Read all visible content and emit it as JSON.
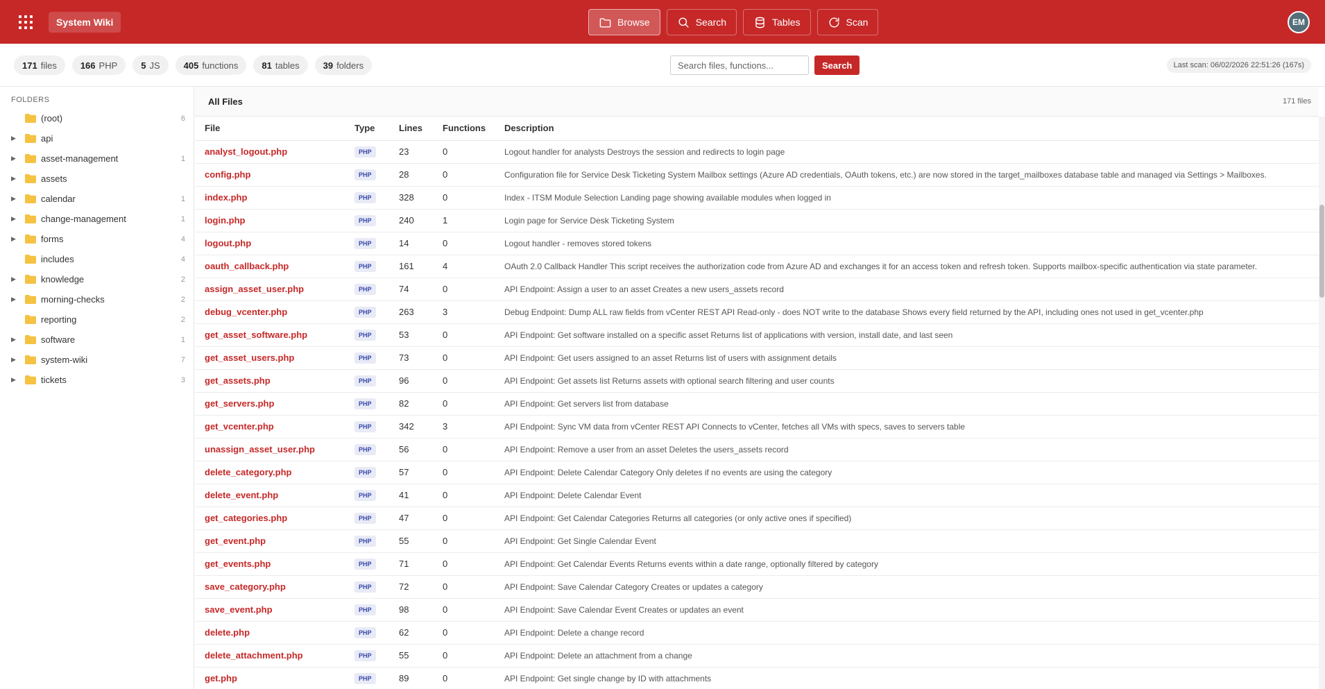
{
  "header": {
    "brand": "System Wiki",
    "nav": [
      {
        "label": "Browse",
        "icon": "folder-icon",
        "active": true
      },
      {
        "label": "Search",
        "icon": "search-icon",
        "active": false
      },
      {
        "label": "Tables",
        "icon": "database-icon",
        "active": false
      },
      {
        "label": "Scan",
        "icon": "refresh-icon",
        "active": false
      }
    ],
    "avatar": "EM"
  },
  "stats": [
    {
      "value": "171",
      "label": "files"
    },
    {
      "value": "166",
      "label": "PHP"
    },
    {
      "value": "5",
      "label": "JS"
    },
    {
      "value": "405",
      "label": "functions"
    },
    {
      "value": "81",
      "label": "tables"
    },
    {
      "value": "39",
      "label": "folders"
    }
  ],
  "search": {
    "placeholder": "Search files, functions...",
    "button": "Search"
  },
  "last_scan": "Last scan: 06/02/2026 22:51:26 (167s)",
  "sidebar": {
    "title": "FOLDERS",
    "folders": [
      {
        "name": "(root)",
        "count": "6",
        "expandable": false
      },
      {
        "name": "api",
        "count": "",
        "expandable": true
      },
      {
        "name": "asset-management",
        "count": "1",
        "expandable": true
      },
      {
        "name": "assets",
        "count": "",
        "expandable": true
      },
      {
        "name": "calendar",
        "count": "1",
        "expandable": true
      },
      {
        "name": "change-management",
        "count": "1",
        "expandable": true
      },
      {
        "name": "forms",
        "count": "4",
        "expandable": true
      },
      {
        "name": "includes",
        "count": "4",
        "expandable": false
      },
      {
        "name": "knowledge",
        "count": "2",
        "expandable": true
      },
      {
        "name": "morning-checks",
        "count": "2",
        "expandable": true
      },
      {
        "name": "reporting",
        "count": "2",
        "expandable": false
      },
      {
        "name": "software",
        "count": "1",
        "expandable": true
      },
      {
        "name": "system-wiki",
        "count": "7",
        "expandable": true
      },
      {
        "name": "tickets",
        "count": "3",
        "expandable": true
      }
    ]
  },
  "main": {
    "title": "All Files",
    "count": "171 files",
    "columns": [
      "File",
      "Type",
      "Lines",
      "Functions",
      "Description"
    ],
    "rows": [
      {
        "file": "analyst_logout.php",
        "type": "PHP",
        "lines": "23",
        "functions": "0",
        "desc": "Logout handler for analysts Destroys the session and redirects to login page"
      },
      {
        "file": "config.php",
        "type": "PHP",
        "lines": "28",
        "functions": "0",
        "desc": "Configuration file for Service Desk Ticketing System Mailbox settings (Azure AD credentials, OAuth tokens, etc.) are now stored in the target_mailboxes database table and managed via Settings > Mailboxes."
      },
      {
        "file": "index.php",
        "type": "PHP",
        "lines": "328",
        "functions": "0",
        "desc": "Index - ITSM Module Selection Landing page showing available modules when logged in"
      },
      {
        "file": "login.php",
        "type": "PHP",
        "lines": "240",
        "functions": "1",
        "desc": "Login page for Service Desk Ticketing System"
      },
      {
        "file": "logout.php",
        "type": "PHP",
        "lines": "14",
        "functions": "0",
        "desc": "Logout handler - removes stored tokens"
      },
      {
        "file": "oauth_callback.php",
        "type": "PHP",
        "lines": "161",
        "functions": "4",
        "desc": "OAuth 2.0 Callback Handler This script receives the authorization code from Azure AD and exchanges it for an access token and refresh token. Supports mailbox-specific authentication via state parameter."
      },
      {
        "file": "assign_asset_user.php",
        "type": "PHP",
        "lines": "74",
        "functions": "0",
        "desc": "API Endpoint: Assign a user to an asset Creates a new users_assets record"
      },
      {
        "file": "debug_vcenter.php",
        "type": "PHP",
        "lines": "263",
        "functions": "3",
        "desc": "Debug Endpoint: Dump ALL raw fields from vCenter REST API Read-only - does NOT write to the database Shows every field returned by the API, including ones not used in get_vcenter.php"
      },
      {
        "file": "get_asset_software.php",
        "type": "PHP",
        "lines": "53",
        "functions": "0",
        "desc": "API Endpoint: Get software installed on a specific asset Returns list of applications with version, install date, and last seen"
      },
      {
        "file": "get_asset_users.php",
        "type": "PHP",
        "lines": "73",
        "functions": "0",
        "desc": "API Endpoint: Get users assigned to an asset Returns list of users with assignment details"
      },
      {
        "file": "get_assets.php",
        "type": "PHP",
        "lines": "96",
        "functions": "0",
        "desc": "API Endpoint: Get assets list Returns assets with optional search filtering and user counts"
      },
      {
        "file": "get_servers.php",
        "type": "PHP",
        "lines": "82",
        "functions": "0",
        "desc": "API Endpoint: Get servers list from database"
      },
      {
        "file": "get_vcenter.php",
        "type": "PHP",
        "lines": "342",
        "functions": "3",
        "desc": "API Endpoint: Sync VM data from vCenter REST API Connects to vCenter, fetches all VMs with specs, saves to servers table"
      },
      {
        "file": "unassign_asset_user.php",
        "type": "PHP",
        "lines": "56",
        "functions": "0",
        "desc": "API Endpoint: Remove a user from an asset Deletes the users_assets record"
      },
      {
        "file": "delete_category.php",
        "type": "PHP",
        "lines": "57",
        "functions": "0",
        "desc": "API Endpoint: Delete Calendar Category Only deletes if no events are using the category"
      },
      {
        "file": "delete_event.php",
        "type": "PHP",
        "lines": "41",
        "functions": "0",
        "desc": "API Endpoint: Delete Calendar Event"
      },
      {
        "file": "get_categories.php",
        "type": "PHP",
        "lines": "47",
        "functions": "0",
        "desc": "API Endpoint: Get Calendar Categories Returns all categories (or only active ones if specified)"
      },
      {
        "file": "get_event.php",
        "type": "PHP",
        "lines": "55",
        "functions": "0",
        "desc": "API Endpoint: Get Single Calendar Event"
      },
      {
        "file": "get_events.php",
        "type": "PHP",
        "lines": "71",
        "functions": "0",
        "desc": "API Endpoint: Get Calendar Events Returns events within a date range, optionally filtered by category"
      },
      {
        "file": "save_category.php",
        "type": "PHP",
        "lines": "72",
        "functions": "0",
        "desc": "API Endpoint: Save Calendar Category Creates or updates a category"
      },
      {
        "file": "save_event.php",
        "type": "PHP",
        "lines": "98",
        "functions": "0",
        "desc": "API Endpoint: Save Calendar Event Creates or updates an event"
      },
      {
        "file": "delete.php",
        "type": "PHP",
        "lines": "62",
        "functions": "0",
        "desc": "API Endpoint: Delete a change record"
      },
      {
        "file": "delete_attachment.php",
        "type": "PHP",
        "lines": "55",
        "functions": "0",
        "desc": "API Endpoint: Delete an attachment from a change"
      },
      {
        "file": "get.php",
        "type": "PHP",
        "lines": "89",
        "functions": "0",
        "desc": "API Endpoint: Get single change by ID with attachments"
      }
    ]
  },
  "colors": {
    "brand": "#c62828",
    "badge_bg": "#e8eaf6",
    "badge_text": "#3949ab",
    "folder": "#f5c242"
  }
}
